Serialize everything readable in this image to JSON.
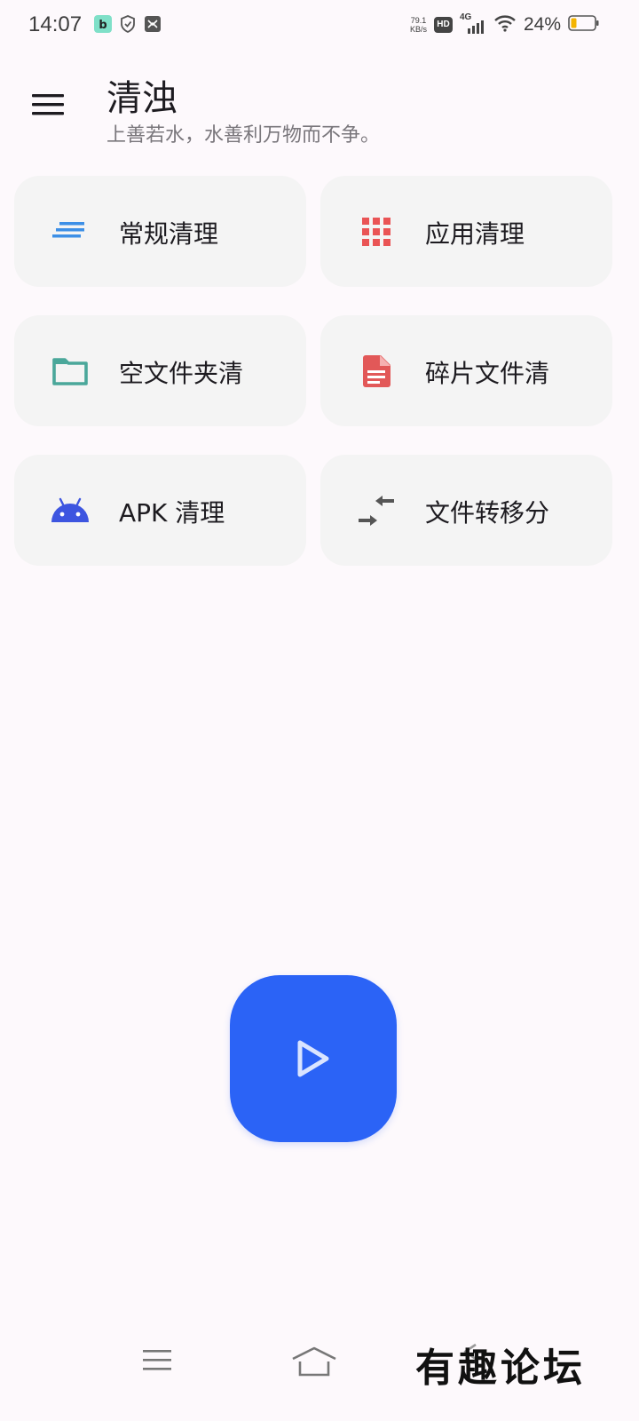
{
  "status_bar": {
    "time": "14:07",
    "net_speed_value": "79.1",
    "net_speed_unit": "KB/s",
    "hd_label": "HD",
    "network_label": "4G",
    "battery_text": "24%",
    "battery_level": 0.24
  },
  "header": {
    "title": "清浊",
    "subtitle": "上善若水，水善利万物而不争。"
  },
  "cards": [
    {
      "label": "常规清理",
      "icon": "lines-icon",
      "color": "#3d8fe6"
    },
    {
      "label": "应用清理",
      "icon": "apps-grid-icon",
      "color": "#ea5455"
    },
    {
      "label": "空文件夹清",
      "icon": "folder-icon",
      "color": "#4aa79a"
    },
    {
      "label": "碎片文件清",
      "icon": "document-icon",
      "color": "#e25858"
    },
    {
      "label": "APK 清理",
      "icon": "android-icon",
      "color": "#3d55e0"
    },
    {
      "label": "文件转移分",
      "icon": "transfer-arrows-icon",
      "color": "#555555"
    }
  ],
  "fab": {
    "icon": "play-icon",
    "color": "#2b63f6"
  },
  "watermark": "有趣论坛"
}
